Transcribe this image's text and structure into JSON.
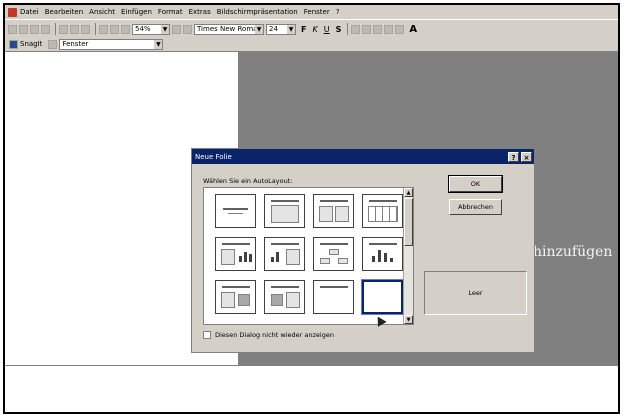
{
  "menubar": {
    "items": [
      "Datei",
      "Bearbeiten",
      "Ansicht",
      "Einfügen",
      "Format",
      "Extras",
      "Bildschirmpräsentation",
      "Fenster",
      "?"
    ]
  },
  "toolbar": {
    "zoom": "54%",
    "font_name": "Times New Roman",
    "font_size": "24",
    "bold": "F",
    "italic": "K",
    "underline": "U",
    "shadow": "S",
    "grow_font": "A"
  },
  "snagit_bar": {
    "snagit_label": "SnagIt",
    "window_select": "Fenster"
  },
  "slide": {
    "placeholder_fragment": "hinzufügen"
  },
  "dialog": {
    "title": "Neue Folie",
    "help_glyph": "?",
    "close_glyph": "×",
    "prompt": "Wählen Sie ein AutoLayout:",
    "ok_label": "OK",
    "cancel_label": "Abbrechen",
    "preview_label": "Leer",
    "checkbox_label": "Diesen Dialog nicht wieder anzeigen",
    "scroll_up": "▲",
    "scroll_down": "▼"
  }
}
